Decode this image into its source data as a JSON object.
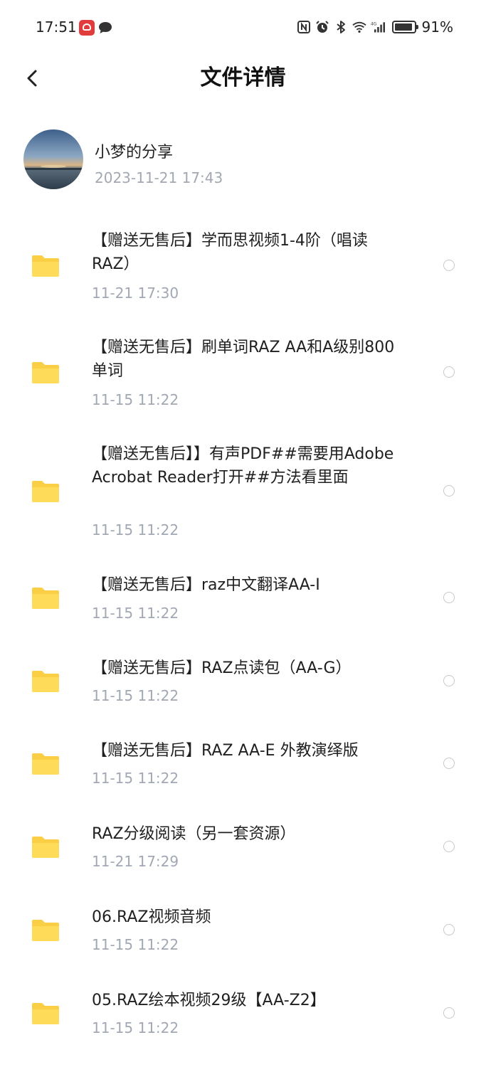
{
  "status_bar": {
    "time": "17:51",
    "battery_pct": "91%"
  },
  "header": {
    "title": "文件详情"
  },
  "sharer": {
    "name": "小梦的分享",
    "time": "2023-11-21  17:43"
  },
  "files": [
    {
      "name": "【赠送无售后】学而思视频1-4阶（唱读RAZ）",
      "time": "11-21  17:30"
    },
    {
      "name": "【赠送无售后】刷单词RAZ AA和A级别800单词",
      "time": "11-15  11:22"
    },
    {
      "name": "【赠送无售后】】有声PDF##需要用Adobe Acrobat Reader打开##方法看里面",
      "time": "11-15  11:22"
    },
    {
      "name": "【赠送无售后】raz中文翻译AA-I",
      "time": "11-15  11:22"
    },
    {
      "name": "【赠送无售后】RAZ点读包（AA-G）",
      "time": "11-15  11:22"
    },
    {
      "name": "【赠送无售后】RAZ AA-E  外教演绎版",
      "time": "11-15  11:22"
    },
    {
      "name": "RAZ分级阅读（另一套资源）",
      "time": "11-21  17:29"
    },
    {
      "name": "06.RAZ视频音频",
      "time": "11-15  11:22"
    },
    {
      "name": "05.RAZ绘本视频29级【AA-Z2】",
      "time": "11-15  11:22"
    }
  ]
}
